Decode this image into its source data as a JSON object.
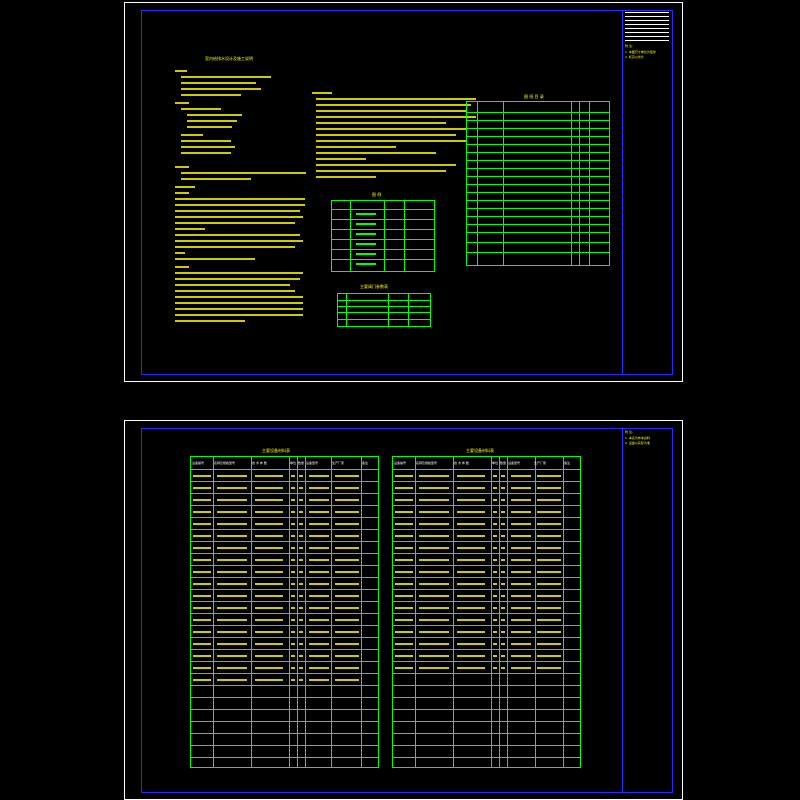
{
  "sheet1": {
    "notes_title": "室内给排水设计及施工说明",
    "table_list_title": "图 纸 目 录",
    "legend_title": "图 例",
    "valves_title": "主要阀门参数表",
    "notes_label": "附 注:",
    "notes_text": "1. 本图尺寸单位为毫米\n2. 标高以米计"
  },
  "sheet2": {
    "left_table_title": "主要设备材料表",
    "right_table_title": "主要设备材料表",
    "col_headers_left": [
      "设备编号",
      "名称及规格型号",
      "技 术 参 数",
      "单位",
      "数量",
      "设备型号",
      "生产厂家",
      "备注"
    ],
    "col_headers_right": [
      "设备编号",
      "名称及规格型号",
      "技 术 参 数",
      "单位",
      "数量",
      "设备型号",
      "生产厂家",
      "备注"
    ],
    "notes_label": "附 注:",
    "notes_text": "1. 本表为参考资料\n2. 设备以实际为准"
  }
}
